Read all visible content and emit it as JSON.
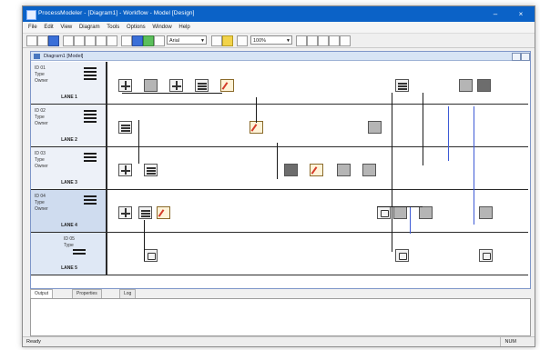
{
  "window": {
    "title": "ProcessModeler - [Diagram1] - Workflow - Model [Design]",
    "minimize": "–",
    "close": "×"
  },
  "menu": [
    "File",
    "Edit",
    "View",
    "Diagram",
    "Tools",
    "Options",
    "Window",
    "Help"
  ],
  "toolbar": {
    "font_combo": "Arial",
    "size_combo": "100%"
  },
  "document": {
    "title": "Diagram1 [Model]"
  },
  "lanes": [
    {
      "name": "LANE 1",
      "lines": [
        "ID 01",
        "Type",
        "Owner"
      ]
    },
    {
      "name": "LANE 2",
      "lines": [
        "ID 02",
        "Type",
        "Owner"
      ]
    },
    {
      "name": "LANE 3",
      "lines": [
        "ID 03",
        "Type",
        "Owner"
      ]
    },
    {
      "name": "LANE 4",
      "lines": [
        "ID 04",
        "Type",
        "Owner"
      ]
    },
    {
      "name": "LANE 5",
      "lines": [
        "ID 05",
        "Type"
      ]
    }
  ],
  "tabs": [
    "Output",
    "Properties",
    "Log"
  ],
  "status": {
    "left": "Ready",
    "right": "NUM"
  }
}
